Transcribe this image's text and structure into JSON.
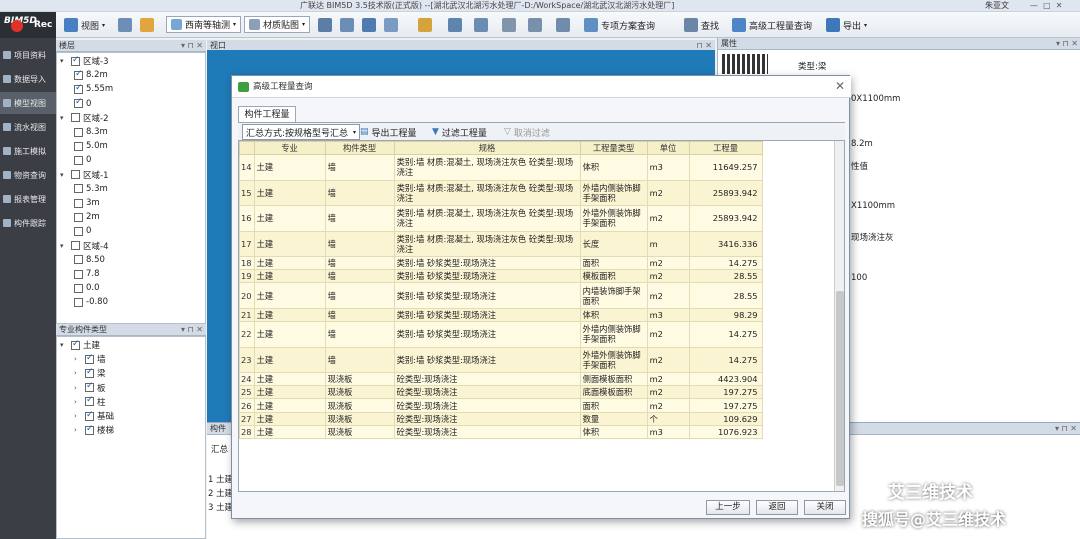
{
  "app_title": "广联达 BIM5D 3.5技术版(正式版) --[湖北武汉北湖污水处理厂-D:/WorkSpace/湖北武汉北湖污水处理厂]",
  "user": "朱亚文",
  "logo": {
    "text": "BIM5D",
    "rec": "Rec"
  },
  "toolbar": {
    "view": "视图",
    "view_mode": "西南等轴测",
    "material": "材质贴图",
    "special_query": "专项方案查询",
    "find": "查找",
    "advanced_query": "高级工程量查询",
    "export": "导出"
  },
  "leftnav": [
    "项目资料",
    "数据导入",
    "模型视图",
    "流水视图",
    "施工模拟",
    "物资查询",
    "报表管理",
    "构件跟踪"
  ],
  "floors_panel": {
    "title": "楼层",
    "rows": [
      {
        "label": "区域-3",
        "checked": true,
        "level": 0
      },
      {
        "label": "8.2m",
        "checked": true,
        "level": 1
      },
      {
        "label": "5.55m",
        "checked": true,
        "level": 1
      },
      {
        "label": "0",
        "checked": true,
        "level": 1
      },
      {
        "label": "区域-2",
        "checked": false,
        "level": 0
      },
      {
        "label": "8.3m",
        "checked": false,
        "level": 1
      },
      {
        "label": "5.0m",
        "checked": false,
        "level": 1
      },
      {
        "label": "0",
        "checked": false,
        "level": 1
      },
      {
        "label": "区域-1",
        "checked": false,
        "level": 0
      },
      {
        "label": "5.3m",
        "checked": false,
        "level": 1
      },
      {
        "label": "3m",
        "checked": false,
        "level": 1
      },
      {
        "label": "2m",
        "checked": false,
        "level": 1
      },
      {
        "label": "0",
        "checked": false,
        "level": 1
      },
      {
        "label": "区域-4",
        "checked": false,
        "level": 0
      },
      {
        "label": "8.50",
        "checked": false,
        "level": 1
      },
      {
        "label": "7.8",
        "checked": false,
        "level": 1
      },
      {
        "label": "0.0",
        "checked": false,
        "level": 1
      },
      {
        "label": "-0.80",
        "checked": false,
        "level": 1
      }
    ]
  },
  "type_panel": {
    "title": "专业构件类型",
    "rows": [
      {
        "label": "土建",
        "level": 0
      },
      {
        "label": "墙",
        "level": 1
      },
      {
        "label": "梁",
        "level": 1
      },
      {
        "label": "板",
        "level": 1
      },
      {
        "label": "柱",
        "level": 1
      },
      {
        "label": "基础",
        "level": 1
      },
      {
        "label": "楼梯",
        "level": 1
      }
    ]
  },
  "viewport": {
    "title": "视口"
  },
  "bottom_panel": {
    "title": "构件",
    "tab": "汇总",
    "rows": [
      "1 土建",
      "2 土建",
      "3 土建"
    ]
  },
  "props": {
    "title": "属性",
    "type_label": "类型:梁",
    "fragments": [
      "0X1100mm",
      "8.2m",
      "性值",
      "X1100mm",
      "现场浇注灰",
      "100"
    ]
  },
  "dialog": {
    "title": "高级工程量查询",
    "tab": "构件工程量",
    "summary_mode": "汇总方式:按规格型号汇总",
    "export_btn": "导出工程量",
    "filter_btn": "过滤工程量",
    "cancel_filter_btn": "取消过滤",
    "columns": [
      "专业",
      "构件类型",
      "规格",
      "工程量类型",
      "单位",
      "工程量"
    ],
    "rows": [
      {
        "no": "14",
        "major": "土建",
        "type": "墙",
        "spec": "类别:墙  材质:混凝土, 现场浇注灰色  砼类型:现场浇注",
        "qtype": "体积",
        "unit": "m3",
        "qty": "11649.257"
      },
      {
        "no": "15",
        "major": "土建",
        "type": "墙",
        "spec": "类别:墙  材质:混凝土, 现场浇注灰色  砼类型:现场浇注",
        "qtype": "外墙内侧装饰脚手架面积",
        "unit": "m2",
        "qty": "25893.942"
      },
      {
        "no": "16",
        "major": "土建",
        "type": "墙",
        "spec": "类别:墙  材质:混凝土, 现场浇注灰色  砼类型:现场浇注",
        "qtype": "外墙外侧装饰脚手架面积",
        "unit": "m2",
        "qty": "25893.942"
      },
      {
        "no": "17",
        "major": "土建",
        "type": "墙",
        "spec": "类别:墙  材质:混凝土, 现场浇注灰色  砼类型:现场浇注",
        "qtype": "长度",
        "unit": "m",
        "qty": "3416.336"
      },
      {
        "no": "18",
        "major": "土建",
        "type": "墙",
        "spec": "类别:墙  砂浆类型:现场浇注",
        "qtype": "面积",
        "unit": "m2",
        "qty": "14.275"
      },
      {
        "no": "19",
        "major": "土建",
        "type": "墙",
        "spec": "类别:墙  砂浆类型:现场浇注",
        "qtype": "模板面积",
        "unit": "m2",
        "qty": "28.55"
      },
      {
        "no": "20",
        "major": "土建",
        "type": "墙",
        "spec": "类别:墙  砂浆类型:现场浇注",
        "qtype": "内墙装饰脚手架面积",
        "unit": "m2",
        "qty": "28.55"
      },
      {
        "no": "21",
        "major": "土建",
        "type": "墙",
        "spec": "类别:墙  砂浆类型:现场浇注",
        "qtype": "体积",
        "unit": "m3",
        "qty": "98.29"
      },
      {
        "no": "22",
        "major": "土建",
        "type": "墙",
        "spec": "类别:墙  砂浆类型:现场浇注",
        "qtype": "外墙内侧装饰脚手架面积",
        "unit": "m2",
        "qty": "14.275"
      },
      {
        "no": "23",
        "major": "土建",
        "type": "墙",
        "spec": "类别:墙  砂浆类型:现场浇注",
        "qtype": "外墙外侧装饰脚手架面积",
        "unit": "m2",
        "qty": "14.275"
      },
      {
        "no": "24",
        "major": "土建",
        "type": "现浇板",
        "spec": "砼类型:现场浇注",
        "qtype": "侧面模板面积",
        "unit": "m2",
        "qty": "4423.904"
      },
      {
        "no": "25",
        "major": "土建",
        "type": "现浇板",
        "spec": "砼类型:现场浇注",
        "qtype": "底面模板面积",
        "unit": "m2",
        "qty": "197.275"
      },
      {
        "no": "26",
        "major": "土建",
        "type": "现浇板",
        "spec": "砼类型:现场浇注",
        "qtype": "面积",
        "unit": "m2",
        "qty": "197.275"
      },
      {
        "no": "27",
        "major": "土建",
        "type": "现浇板",
        "spec": "砼类型:现场浇注",
        "qtype": "数量",
        "unit": "个",
        "qty": "109.629"
      },
      {
        "no": "28",
        "major": "土建",
        "type": "现浇板",
        "spec": "砼类型:现场浇注",
        "qtype": "体积",
        "unit": "m3",
        "qty": "1076.923"
      }
    ],
    "buttons": {
      "prev": "上一步",
      "back": "返回",
      "close": "关闭"
    }
  },
  "watermark": {
    "line1": "艾三维技术",
    "line2": "搜狐号@艾三维技术"
  },
  "colors": {
    "accent": "#1f7ab8",
    "row_odd": "#fffbe2",
    "row_even": "#fbf4d2",
    "header": "#f5f0c8",
    "nav_bg": "#3b3f45"
  }
}
